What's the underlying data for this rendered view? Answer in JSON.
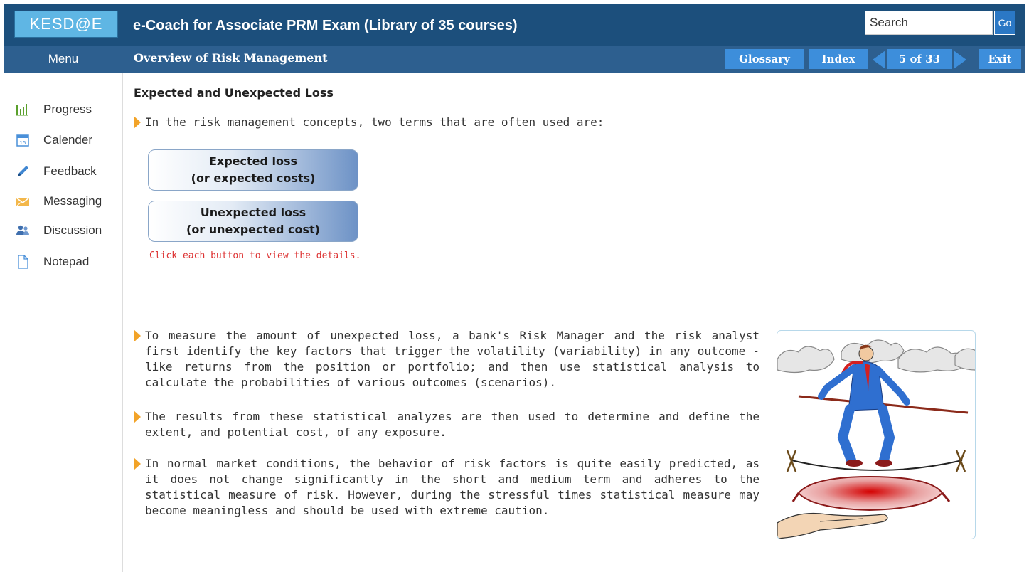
{
  "header": {
    "logo_text": "KESD@E",
    "app_title": "e-Coach for Associate PRM Exam (Library of 35 courses)",
    "search_placeholder": "Search",
    "go_label": "Go"
  },
  "subbar": {
    "menu_label": "Menu",
    "section_title": "Overview of Risk Management",
    "glossary_label": "Glossary",
    "index_label": "Index",
    "page_indicator": "5 of 33",
    "exit_label": "Exit"
  },
  "sidebar": {
    "items": [
      {
        "label": "Progress",
        "icon": "bar-chart-icon"
      },
      {
        "label": "Calender",
        "icon": "calendar-icon"
      },
      {
        "label": "Feedback",
        "icon": "pencil-icon"
      },
      {
        "label": "Messaging",
        "icon": "envelope-icon"
      },
      {
        "label": "Discussion",
        "icon": "users-icon"
      },
      {
        "label": "Notepad",
        "icon": "document-icon"
      }
    ]
  },
  "main": {
    "heading": "Expected and Unexpected Loss",
    "intro": "In the risk management concepts, two terms that are often used are:",
    "buttons": [
      {
        "line1": "Expected loss",
        "line2": "(or expected costs)"
      },
      {
        "line1": "Unexpected loss",
        "line2": "(or unexpected cost)"
      }
    ],
    "hint": "Click each button to view the details.",
    "paragraphs": [
      "To measure the amount of unexpected loss, a bank's Risk Manager and the risk analyst first identify the key factors that trigger the volatility (variability) in any outcome - like returns from the position or portfolio; and then use statistical analysis to calculate the probabilities of various outcomes (scenarios).",
      "The results from these statistical analyzes are then used to determine and define the extent, and potential cost, of any exposure.",
      "In normal market conditions, the behavior of risk factors is quite easily predicted, as it does not change significantly in the short and medium term and adheres to the statistical measure of risk. However, during the stressful times statistical measure may become meaningless and should be used with extreme caution."
    ]
  },
  "colors": {
    "header_bg": "#1c4f7c",
    "subbar_bg": "#2d5f8f",
    "nav_button": "#3d8edb",
    "bullet": "#f2a328",
    "hint": "#dd3333"
  }
}
